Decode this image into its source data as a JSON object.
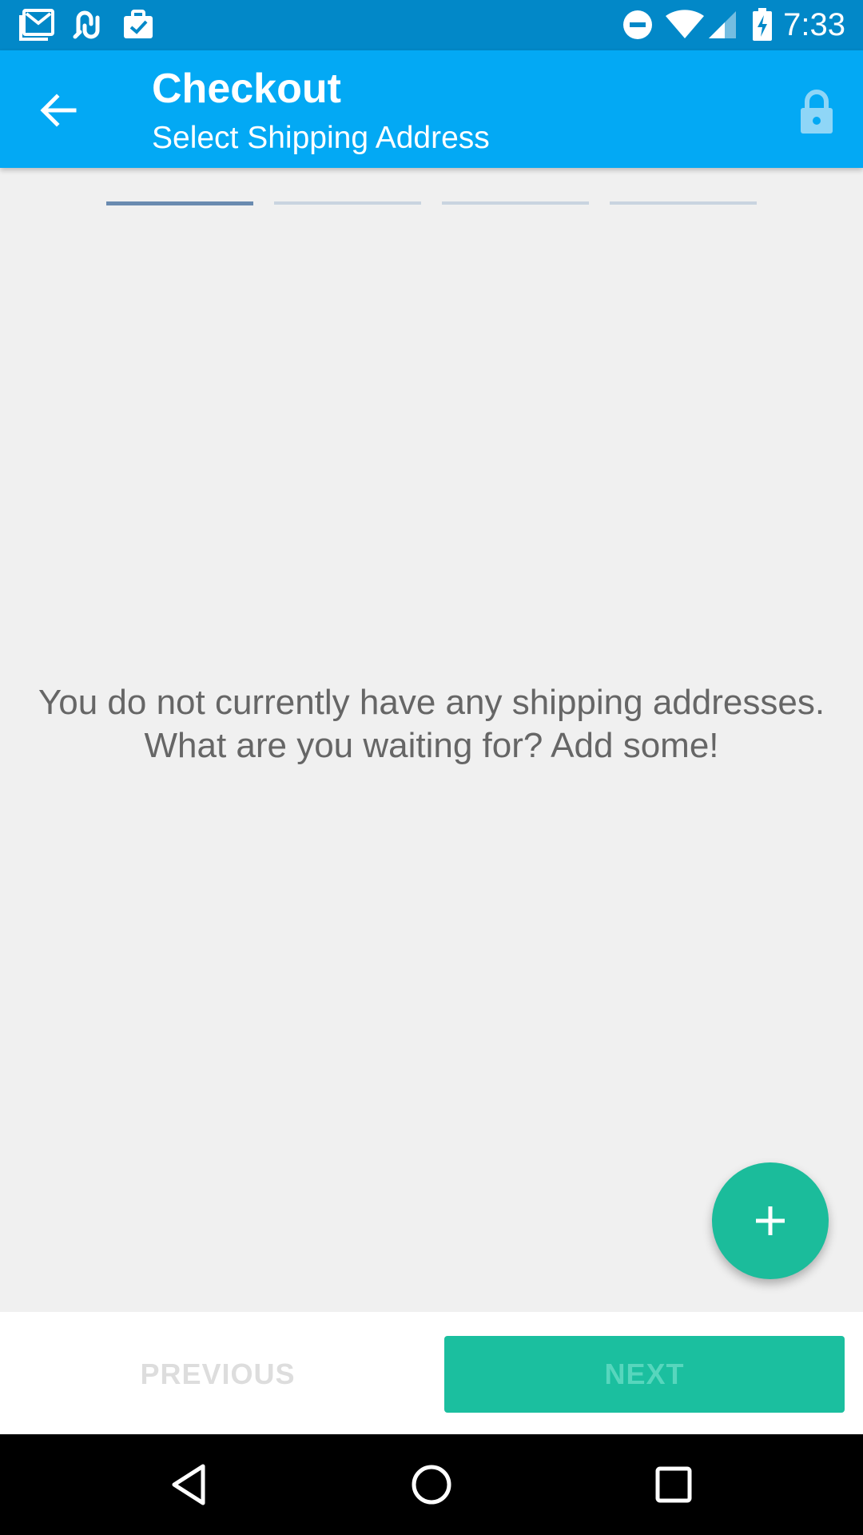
{
  "status_bar": {
    "time": "7:33",
    "icons": [
      "gmail-icon",
      "link-icon",
      "briefcase-check-icon",
      "do-not-disturb-icon",
      "wifi-icon",
      "signal-icon",
      "battery-charging-icon"
    ]
  },
  "app_bar": {
    "title": "Checkout",
    "subtitle": "Select Shipping Address",
    "back_icon": "arrow-back-icon",
    "secure_icon": "lock-icon"
  },
  "progress": {
    "total_steps": 4,
    "current_step": 1
  },
  "empty_state": {
    "line1": "You do not currently have any shipping addresses.",
    "line2": "What are you waiting for? Add some!"
  },
  "fab": {
    "icon": "plus-icon"
  },
  "actions": {
    "previous_label": "PREVIOUS",
    "next_label": "NEXT"
  },
  "navigation": {
    "icons": [
      "nav-back-icon",
      "nav-home-icon",
      "nav-recents-icon"
    ]
  },
  "colors": {
    "status_bar": "#0288c8",
    "app_bar": "#03a9f4",
    "accent": "#1bbc9b",
    "background": "#f0f0f0"
  }
}
